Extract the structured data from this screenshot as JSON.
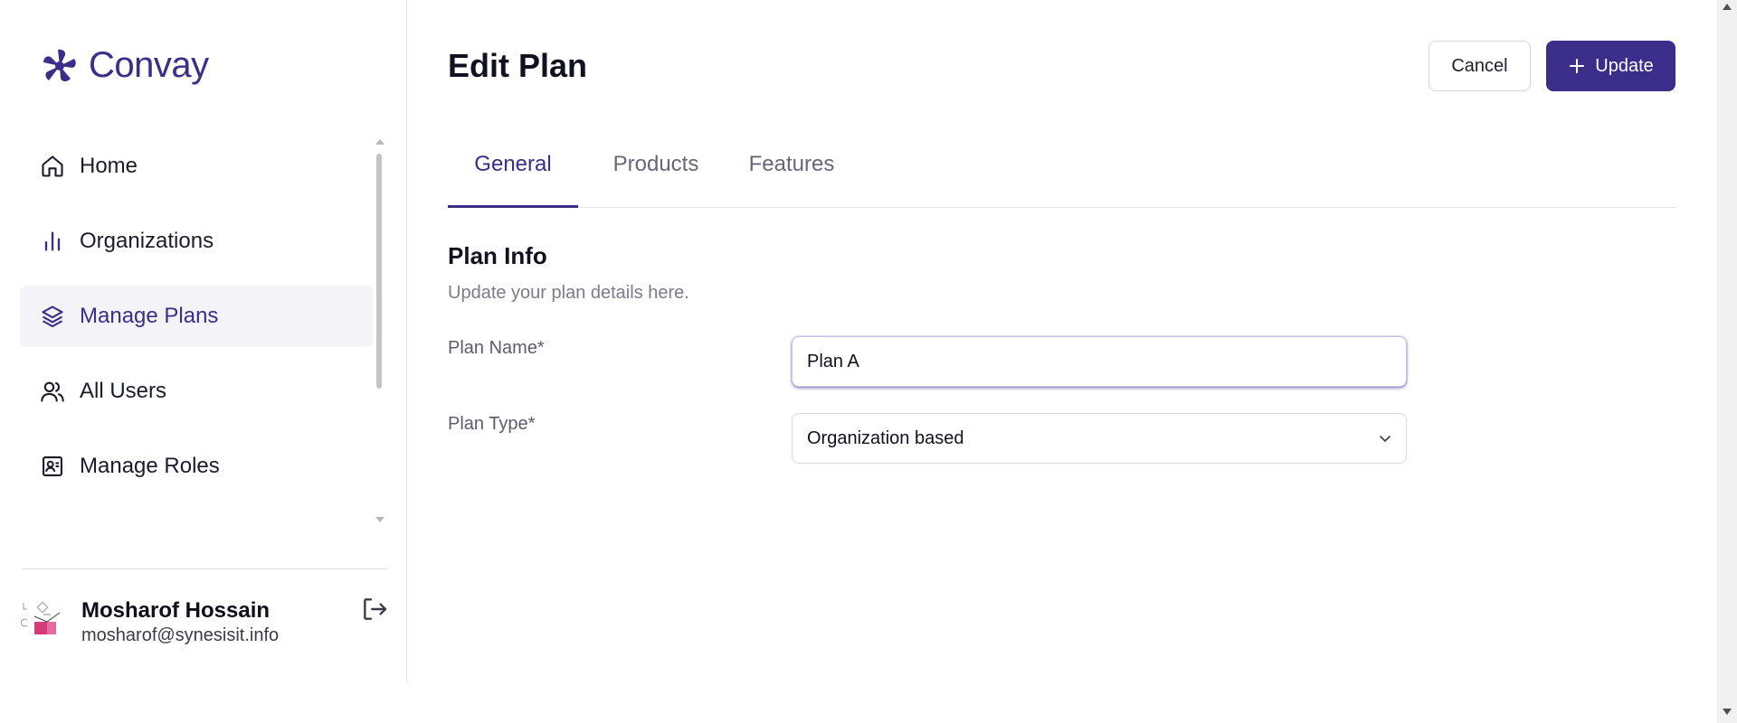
{
  "brand": {
    "name": "Convay",
    "color": "#3b2d8a"
  },
  "sidebar": {
    "items": [
      {
        "label": "Home",
        "icon": "home-icon",
        "active": false
      },
      {
        "label": "Organizations",
        "icon": "bar-chart-icon",
        "active": false
      },
      {
        "label": "Manage Plans",
        "icon": "layers-icon",
        "active": true
      },
      {
        "label": "All Users",
        "icon": "users-icon",
        "active": false
      },
      {
        "label": "Manage Roles",
        "icon": "user-card-icon",
        "active": false
      }
    ]
  },
  "user": {
    "name": "Mosharof Hossain",
    "email": "mosharof@synesisit.info"
  },
  "header": {
    "title": "Edit Plan",
    "cancel_label": "Cancel",
    "update_label": "Update"
  },
  "tabs": [
    {
      "label": "General",
      "active": true
    },
    {
      "label": "Products",
      "active": false
    },
    {
      "label": "Features",
      "active": false
    }
  ],
  "section": {
    "title": "Plan Info",
    "description": "Update your plan details here."
  },
  "form": {
    "plan_name_label": "Plan Name*",
    "plan_name_value": "Plan A",
    "plan_type_label": "Plan Type*",
    "plan_type_value": "Organization based"
  }
}
